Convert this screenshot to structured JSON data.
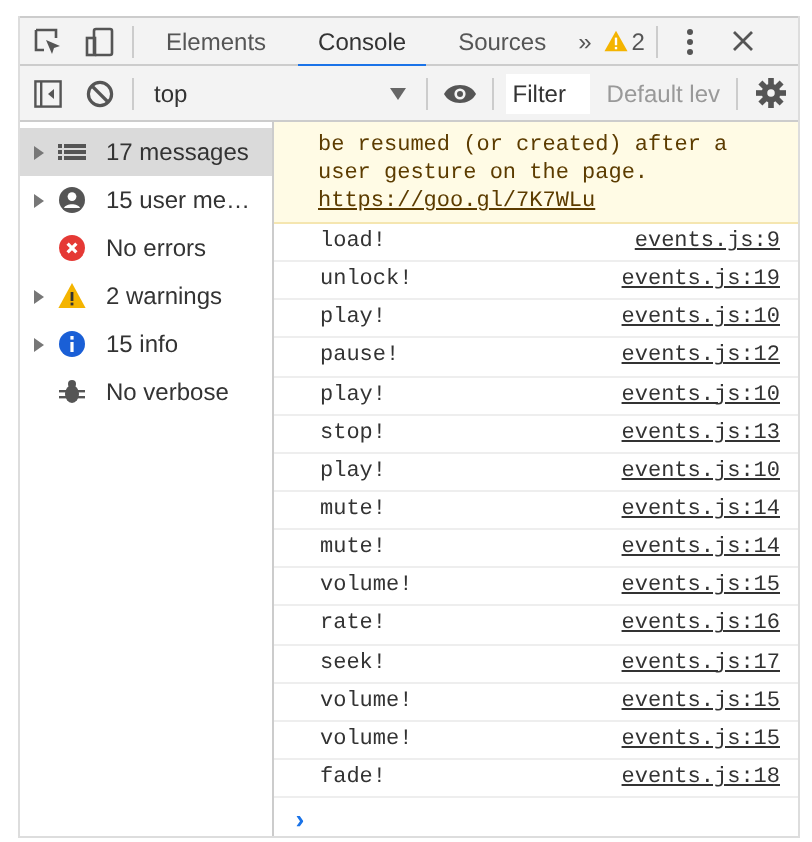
{
  "toolbar": {
    "tabs": [
      {
        "label": "Elements",
        "selected": false
      },
      {
        "label": "Console",
        "selected": true
      },
      {
        "label": "Sources",
        "selected": false
      }
    ],
    "overflow": "»",
    "warning_count": "2"
  },
  "console_toolbar": {
    "context": "top",
    "filter": {
      "placeholder": "Filter"
    },
    "level": "Default lev"
  },
  "sidebar": {
    "items": [
      {
        "kind": "list",
        "label": "17 messages",
        "expandable": true,
        "selected": true
      },
      {
        "kind": "user",
        "label": "15 user me…",
        "expandable": true,
        "selected": false
      },
      {
        "kind": "error",
        "label": "No errors",
        "expandable": false,
        "selected": false
      },
      {
        "kind": "warning",
        "label": "2 warnings",
        "expandable": true,
        "selected": false
      },
      {
        "kind": "info",
        "label": "15 info",
        "expandable": true,
        "selected": false
      },
      {
        "kind": "verbose",
        "label": "No verbose",
        "expandable": false,
        "selected": false
      }
    ]
  },
  "warning": {
    "text": "be resumed (or created) after a user gesture on the page.",
    "link": "https://goo.gl/7K7WLu"
  },
  "messages": [
    {
      "text": "load!",
      "source": "events.js:9"
    },
    {
      "text": "unlock!",
      "source": "events.js:19"
    },
    {
      "text": "play!",
      "source": "events.js:10"
    },
    {
      "text": "pause!",
      "source": "events.js:12"
    },
    {
      "text": "play!",
      "source": "events.js:10"
    },
    {
      "text": "stop!",
      "source": "events.js:13"
    },
    {
      "text": "play!",
      "source": "events.js:10"
    },
    {
      "text": "mute!",
      "source": "events.js:14"
    },
    {
      "text": "mute!",
      "source": "events.js:14"
    },
    {
      "text": "volume!",
      "source": "events.js:15"
    },
    {
      "text": "rate!",
      "source": "events.js:16"
    },
    {
      "text": "seek!",
      "source": "events.js:17"
    },
    {
      "text": "volume!",
      "source": "events.js:15"
    },
    {
      "text": "volume!",
      "source": "events.js:15"
    },
    {
      "text": "fade!",
      "source": "events.js:18"
    }
  ],
  "prompt": "›"
}
